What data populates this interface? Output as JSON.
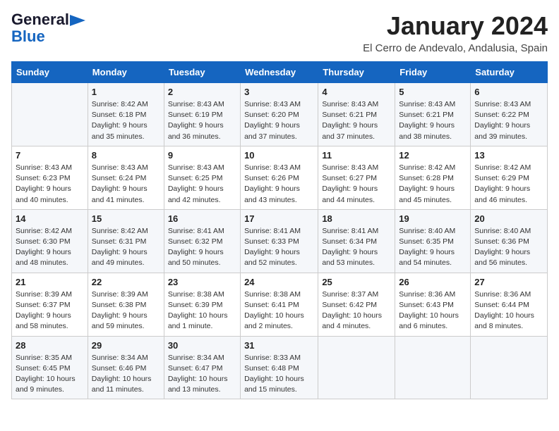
{
  "header": {
    "logo_general": "General",
    "logo_blue": "Blue",
    "title": "January 2024",
    "location": "El Cerro de Andevalo, Andalusia, Spain"
  },
  "days_of_week": [
    "Sunday",
    "Monday",
    "Tuesday",
    "Wednesday",
    "Thursday",
    "Friday",
    "Saturday"
  ],
  "weeks": [
    [
      {
        "num": "",
        "info": ""
      },
      {
        "num": "1",
        "info": "Sunrise: 8:42 AM\nSunset: 6:18 PM\nDaylight: 9 hours\nand 35 minutes."
      },
      {
        "num": "2",
        "info": "Sunrise: 8:43 AM\nSunset: 6:19 PM\nDaylight: 9 hours\nand 36 minutes."
      },
      {
        "num": "3",
        "info": "Sunrise: 8:43 AM\nSunset: 6:20 PM\nDaylight: 9 hours\nand 37 minutes."
      },
      {
        "num": "4",
        "info": "Sunrise: 8:43 AM\nSunset: 6:21 PM\nDaylight: 9 hours\nand 37 minutes."
      },
      {
        "num": "5",
        "info": "Sunrise: 8:43 AM\nSunset: 6:21 PM\nDaylight: 9 hours\nand 38 minutes."
      },
      {
        "num": "6",
        "info": "Sunrise: 8:43 AM\nSunset: 6:22 PM\nDaylight: 9 hours\nand 39 minutes."
      }
    ],
    [
      {
        "num": "7",
        "info": "Sunrise: 8:43 AM\nSunset: 6:23 PM\nDaylight: 9 hours\nand 40 minutes."
      },
      {
        "num": "8",
        "info": "Sunrise: 8:43 AM\nSunset: 6:24 PM\nDaylight: 9 hours\nand 41 minutes."
      },
      {
        "num": "9",
        "info": "Sunrise: 8:43 AM\nSunset: 6:25 PM\nDaylight: 9 hours\nand 42 minutes."
      },
      {
        "num": "10",
        "info": "Sunrise: 8:43 AM\nSunset: 6:26 PM\nDaylight: 9 hours\nand 43 minutes."
      },
      {
        "num": "11",
        "info": "Sunrise: 8:43 AM\nSunset: 6:27 PM\nDaylight: 9 hours\nand 44 minutes."
      },
      {
        "num": "12",
        "info": "Sunrise: 8:42 AM\nSunset: 6:28 PM\nDaylight: 9 hours\nand 45 minutes."
      },
      {
        "num": "13",
        "info": "Sunrise: 8:42 AM\nSunset: 6:29 PM\nDaylight: 9 hours\nand 46 minutes."
      }
    ],
    [
      {
        "num": "14",
        "info": "Sunrise: 8:42 AM\nSunset: 6:30 PM\nDaylight: 9 hours\nand 48 minutes."
      },
      {
        "num": "15",
        "info": "Sunrise: 8:42 AM\nSunset: 6:31 PM\nDaylight: 9 hours\nand 49 minutes."
      },
      {
        "num": "16",
        "info": "Sunrise: 8:41 AM\nSunset: 6:32 PM\nDaylight: 9 hours\nand 50 minutes."
      },
      {
        "num": "17",
        "info": "Sunrise: 8:41 AM\nSunset: 6:33 PM\nDaylight: 9 hours\nand 52 minutes."
      },
      {
        "num": "18",
        "info": "Sunrise: 8:41 AM\nSunset: 6:34 PM\nDaylight: 9 hours\nand 53 minutes."
      },
      {
        "num": "19",
        "info": "Sunrise: 8:40 AM\nSunset: 6:35 PM\nDaylight: 9 hours\nand 54 minutes."
      },
      {
        "num": "20",
        "info": "Sunrise: 8:40 AM\nSunset: 6:36 PM\nDaylight: 9 hours\nand 56 minutes."
      }
    ],
    [
      {
        "num": "21",
        "info": "Sunrise: 8:39 AM\nSunset: 6:37 PM\nDaylight: 9 hours\nand 58 minutes."
      },
      {
        "num": "22",
        "info": "Sunrise: 8:39 AM\nSunset: 6:38 PM\nDaylight: 9 hours\nand 59 minutes."
      },
      {
        "num": "23",
        "info": "Sunrise: 8:38 AM\nSunset: 6:39 PM\nDaylight: 10 hours\nand 1 minute."
      },
      {
        "num": "24",
        "info": "Sunrise: 8:38 AM\nSunset: 6:41 PM\nDaylight: 10 hours\nand 2 minutes."
      },
      {
        "num": "25",
        "info": "Sunrise: 8:37 AM\nSunset: 6:42 PM\nDaylight: 10 hours\nand 4 minutes."
      },
      {
        "num": "26",
        "info": "Sunrise: 8:36 AM\nSunset: 6:43 PM\nDaylight: 10 hours\nand 6 minutes."
      },
      {
        "num": "27",
        "info": "Sunrise: 8:36 AM\nSunset: 6:44 PM\nDaylight: 10 hours\nand 8 minutes."
      }
    ],
    [
      {
        "num": "28",
        "info": "Sunrise: 8:35 AM\nSunset: 6:45 PM\nDaylight: 10 hours\nand 9 minutes."
      },
      {
        "num": "29",
        "info": "Sunrise: 8:34 AM\nSunset: 6:46 PM\nDaylight: 10 hours\nand 11 minutes."
      },
      {
        "num": "30",
        "info": "Sunrise: 8:34 AM\nSunset: 6:47 PM\nDaylight: 10 hours\nand 13 minutes."
      },
      {
        "num": "31",
        "info": "Sunrise: 8:33 AM\nSunset: 6:48 PM\nDaylight: 10 hours\nand 15 minutes."
      },
      {
        "num": "",
        "info": ""
      },
      {
        "num": "",
        "info": ""
      },
      {
        "num": "",
        "info": ""
      }
    ]
  ]
}
